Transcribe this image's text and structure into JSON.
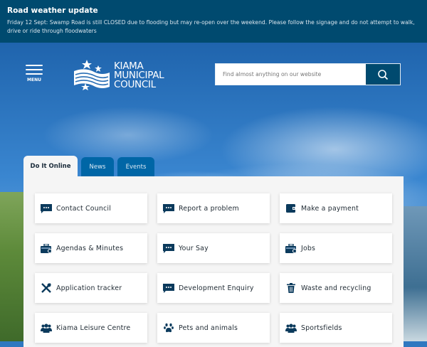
{
  "banner": {
    "title": "Road weather update",
    "message": "Friday 12 Sept: Swamp Road is still CLOSED due to flooding but may re-open over the weekend. Please follow the signage and do not attempt to walk, drive or ride through floodwaters"
  },
  "header": {
    "menu_label": "MENU",
    "logo": {
      "line1": "KIAMA",
      "line2": "MUNICIPAL",
      "line3": "COUNCIL"
    },
    "search_placeholder": "Find almost anything on our website",
    "search_icon": "search-icon"
  },
  "tabs": [
    {
      "label": "Do It Online",
      "active": true
    },
    {
      "label": "News"
    },
    {
      "label": "Events"
    }
  ],
  "colors": {
    "brand": "#004a6f",
    "tab": "#0066a6"
  },
  "services": [
    {
      "label": "Contact Council",
      "icon": "chat"
    },
    {
      "label": "Report a problem",
      "icon": "chat"
    },
    {
      "label": "Make a payment",
      "icon": "wallet"
    },
    {
      "label": "Agendas & Minutes",
      "icon": "briefcase"
    },
    {
      "label": "Your Say",
      "icon": "chat"
    },
    {
      "label": "Jobs",
      "icon": "briefcase"
    },
    {
      "label": "Application tracker",
      "icon": "tools"
    },
    {
      "label": "Development Enquiry",
      "icon": "chat"
    },
    {
      "label": "Waste and recycling",
      "icon": "trash"
    },
    {
      "label": "Kiama Leisure Centre",
      "icon": "users"
    },
    {
      "label": "Pets and animals",
      "icon": "paw"
    },
    {
      "label": "Sportsfields",
      "icon": "users"
    }
  ]
}
